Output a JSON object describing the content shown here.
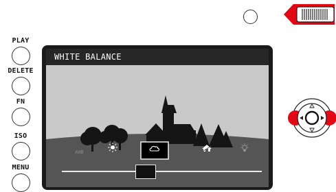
{
  "left_buttons": [
    {
      "id": "play",
      "label": "PLAY"
    },
    {
      "id": "delete",
      "label": "DELETE"
    },
    {
      "id": "fn",
      "label": "FN"
    },
    {
      "id": "iso",
      "label": "ISO"
    },
    {
      "id": "menu",
      "label": "MENU"
    }
  ],
  "screen": {
    "title": "WHITE BALANCE",
    "options": [
      {
        "id": "awb",
        "label": "AWB",
        "icon": "auto-white-balance-icon"
      },
      {
        "id": "daylight",
        "label": "",
        "icon": "sun-icon"
      },
      {
        "id": "cloudy",
        "label": "",
        "icon": "cloud-icon",
        "selected": true
      },
      {
        "id": "shade",
        "label": "",
        "icon": "shade-house-icon"
      },
      {
        "id": "tungsten",
        "label": "",
        "icon": "bulb-icon"
      }
    ],
    "selected_option": "cloudy"
  },
  "colors": {
    "accent_red": "#e30613",
    "screen_bezel": "#1a1a1a",
    "lcd_background": "#c9c9c9",
    "scene_silhouette": "#151515",
    "header_bar": "#262626"
  }
}
